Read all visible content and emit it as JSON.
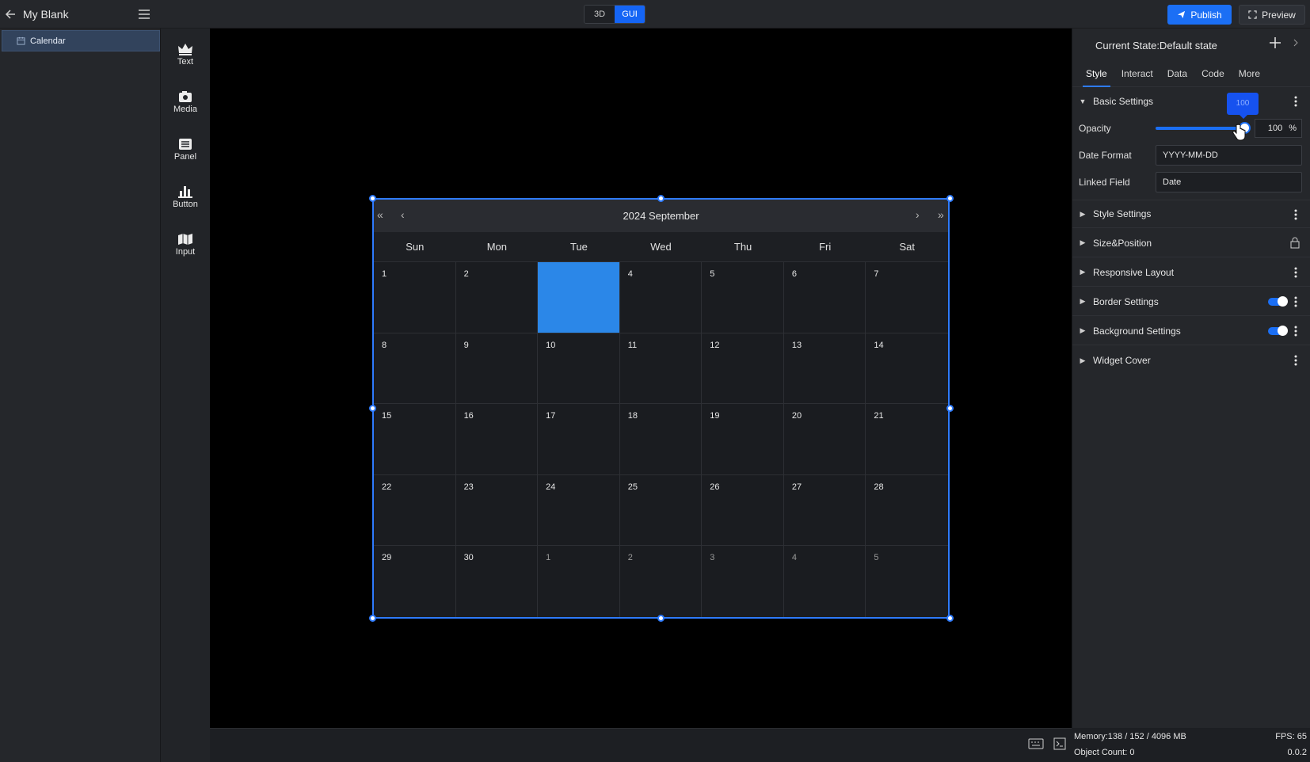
{
  "header": {
    "title": "My Blank",
    "mode_3d": "3D",
    "mode_gui": "GUI",
    "publish": "Publish",
    "preview": "Preview"
  },
  "layers": {
    "items": [
      {
        "label": "Calendar",
        "icon": "calendar-icon"
      }
    ]
  },
  "widgets": [
    {
      "label": "Text",
      "icon": "crown-icon"
    },
    {
      "label": "Media",
      "icon": "media-icon"
    },
    {
      "label": "Panel",
      "icon": "panel-icon"
    },
    {
      "label": "Button",
      "icon": "bar-chart-icon"
    },
    {
      "label": "Input",
      "icon": "map-icon"
    }
  ],
  "calendar": {
    "title": "2024 September",
    "weekdays": [
      "Sun",
      "Mon",
      "Tue",
      "Wed",
      "Thu",
      "Fri",
      "Sat"
    ],
    "days": [
      {
        "n": "1"
      },
      {
        "n": "2"
      },
      {
        "n": "",
        "selected": true
      },
      {
        "n": "4"
      },
      {
        "n": "5"
      },
      {
        "n": "6"
      },
      {
        "n": "7"
      },
      {
        "n": "8"
      },
      {
        "n": "9"
      },
      {
        "n": "10"
      },
      {
        "n": "11"
      },
      {
        "n": "12"
      },
      {
        "n": "13"
      },
      {
        "n": "14"
      },
      {
        "n": "15"
      },
      {
        "n": "16"
      },
      {
        "n": "17"
      },
      {
        "n": "18"
      },
      {
        "n": "19"
      },
      {
        "n": "20"
      },
      {
        "n": "21"
      },
      {
        "n": "22"
      },
      {
        "n": "23"
      },
      {
        "n": "24"
      },
      {
        "n": "25"
      },
      {
        "n": "26"
      },
      {
        "n": "27"
      },
      {
        "n": "28"
      },
      {
        "n": "29"
      },
      {
        "n": "30"
      },
      {
        "n": "1",
        "other": true
      },
      {
        "n": "2",
        "other": true
      },
      {
        "n": "3",
        "other": true
      },
      {
        "n": "4",
        "other": true
      },
      {
        "n": "5",
        "other": true
      }
    ]
  },
  "props": {
    "state": "Current State:Default state",
    "tabs": [
      "Style",
      "Interact",
      "Data",
      "Code",
      "More"
    ],
    "active_tab": "Style",
    "basic": "Basic Settings",
    "tooltip": "100",
    "opacity_label": "Opacity",
    "opacity_value": "100",
    "opacity_unit": "%",
    "opacity_level": 1.0,
    "date_format_label": "Date Format",
    "date_format_value": "YYYY-MM-DD",
    "linked_field_label": "Linked Field",
    "linked_field_value": "Date",
    "sections": [
      {
        "label": "Style Settings",
        "control": "menu"
      },
      {
        "label": "Size&Position",
        "control": "lock"
      },
      {
        "label": "Responsive Layout",
        "control": "menu"
      },
      {
        "label": "Border Settings",
        "control": "toggle",
        "on": true
      },
      {
        "label": "Background Settings",
        "control": "toggle",
        "on": true
      },
      {
        "label": "Widget Cover",
        "control": "menu"
      }
    ]
  },
  "status": {
    "memory": "Memory:138 / 152 / 4096 MB",
    "objects": "Object Count: 0",
    "fps": "FPS: 65",
    "version": "0.0.2"
  },
  "colors": {
    "accent": "#1b6ff5",
    "selected_day": "#2b87e8"
  }
}
